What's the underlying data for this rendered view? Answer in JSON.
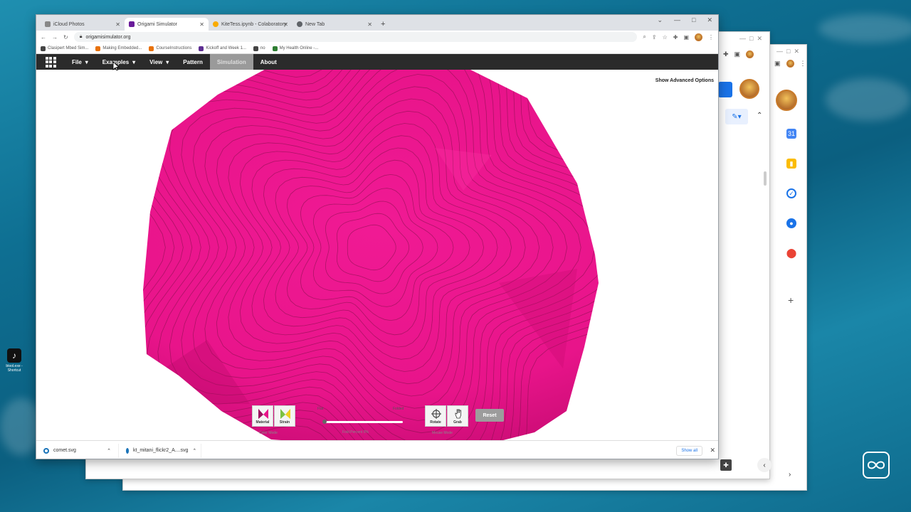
{
  "browser": {
    "tabs": [
      {
        "label": "iCloud Photos",
        "icon": "apple-icon",
        "color": "#888888"
      },
      {
        "label": "Origami Simulator",
        "icon": "origami-icon",
        "color": "#6a1b9a"
      },
      {
        "label": "KiteTess.ipynb - Colaboratory",
        "icon": "colab-icon",
        "color": "#f9ab00"
      },
      {
        "label": "New Tab",
        "icon": "chrome-icon",
        "color": "#5f6368"
      }
    ],
    "url": "origamisimulator.org",
    "bookmarks": [
      {
        "label": "Clasipert Mbed Sim...",
        "color": "#444444"
      },
      {
        "label": "Making Embedded...",
        "color": "#e8710a"
      },
      {
        "label": "CourseInstructions",
        "color": "#e8710a"
      },
      {
        "label": "Kickoff and Week 1...",
        "color": "#5c2d91"
      },
      {
        "label": "no",
        "color": "#444444"
      },
      {
        "label": "My Health Online -...",
        "color": "#2e7d32"
      }
    ]
  },
  "app": {
    "menu": [
      {
        "label": "File",
        "dropdown": true
      },
      {
        "label": "Examples",
        "dropdown": true
      },
      {
        "label": "View",
        "dropdown": true
      },
      {
        "label": "Pattern",
        "dropdown": false
      },
      {
        "label": "Simulation",
        "dropdown": false,
        "selected": true
      },
      {
        "label": "About",
        "dropdown": false
      }
    ],
    "advanced_options": "Show Advanced Options",
    "model_color": "#e8148a",
    "controls": {
      "material": "Material",
      "strain": "Strain",
      "color_mode": "Color Mode",
      "flat": "Flat",
      "folded": "Folded",
      "fold_percent": "Fold Percent 0%",
      "fold_fraction": 0,
      "rotate": "Rotate",
      "grab": "Grab",
      "mouse_mode": "Mouse Mode",
      "reset": "Reset"
    }
  },
  "downloads": {
    "items": [
      {
        "label": "comet.svg"
      },
      {
        "label": "kt_mitani_flickr2_A....svg"
      }
    ],
    "show_all": "Show all"
  },
  "desktop": {
    "shortcut_label": "btool.exe - Shortcut"
  }
}
